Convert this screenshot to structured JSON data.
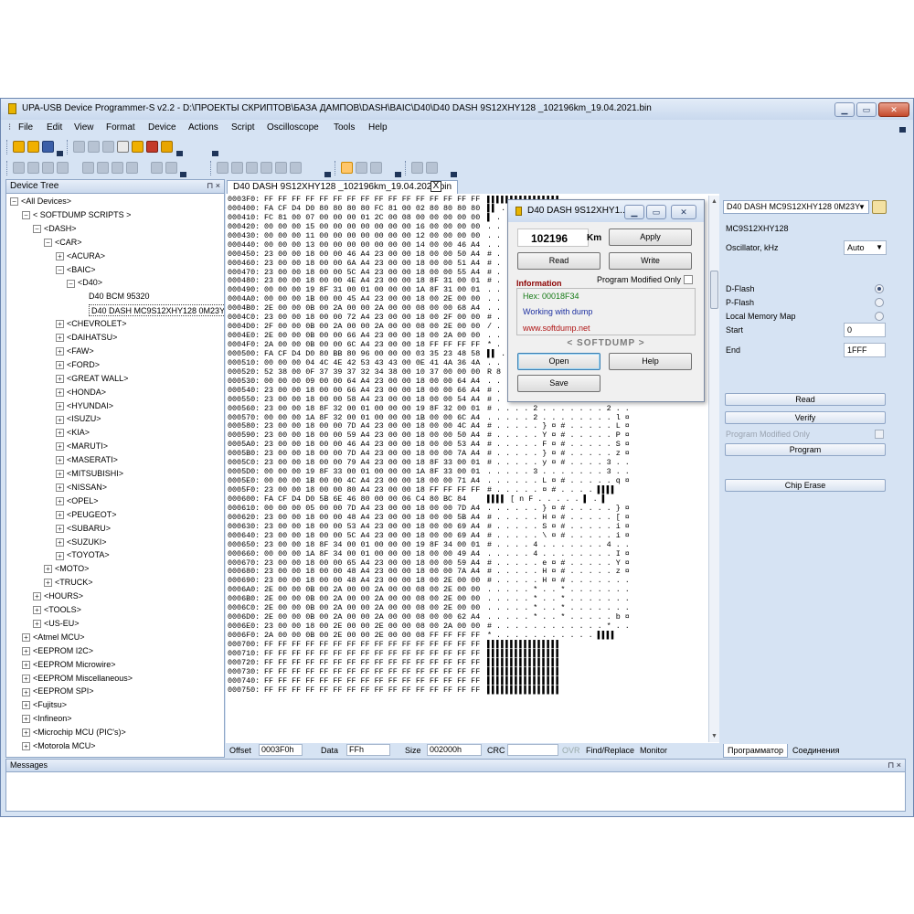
{
  "window": {
    "title": "UPA-USB Device Programmer-S v2.2 - D:\\ПРОЕКТЫ СКРИПТОВ\\БАЗА ДАМПОВ\\DASH\\BAIC\\D40\\D40 DASH 9S12XHY128 _102196km_19.04.2021.bin"
  },
  "menu": [
    "File",
    "Edit",
    "View",
    "Format",
    "Device",
    "Actions",
    "Script",
    "Oscilloscope",
    "Tools",
    "Help"
  ],
  "device_tree": {
    "title": "Device Tree",
    "pin": "⊓ ×",
    "nodes": [
      {
        "label": "<All Devices>",
        "box": "−"
      },
      {
        "label": "< SOFTDUMP SCRIPTS >",
        "box": "−"
      },
      {
        "label": "<DASH>",
        "box": "−"
      },
      {
        "label": "<CAR>",
        "box": "−"
      },
      {
        "label": "<ACURA>",
        "box": "+"
      },
      {
        "label": "<BAIC>",
        "box": "−"
      },
      {
        "label": "<D40>",
        "box": "−"
      },
      {
        "label": "D40 BCM 95320",
        "box": ""
      },
      {
        "label": "D40 DASH MC9S12XHY128 0M23Y",
        "box": ""
      },
      {
        "label": "<CHEVROLET>",
        "box": "+"
      },
      {
        "label": "<DAIHATSU>",
        "box": "+"
      },
      {
        "label": "<FAW>",
        "box": "+"
      },
      {
        "label": "<FORD>",
        "box": "+"
      },
      {
        "label": "<GREAT WALL>",
        "box": "+"
      },
      {
        "label": "<HONDA>",
        "box": "+"
      },
      {
        "label": "<HYUNDAI>",
        "box": "+"
      },
      {
        "label": "<ISUZU>",
        "box": "+"
      },
      {
        "label": "<KIA>",
        "box": "+"
      },
      {
        "label": "<MARUTI>",
        "box": "+"
      },
      {
        "label": "<MASERATI>",
        "box": "+"
      },
      {
        "label": "<MITSUBISHI>",
        "box": "+"
      },
      {
        "label": "<NISSAN>",
        "box": "+"
      },
      {
        "label": "<OPEL>",
        "box": "+"
      },
      {
        "label": "<PEUGEOT>",
        "box": "+"
      },
      {
        "label": "<SUBARU>",
        "box": "+"
      },
      {
        "label": "<SUZUKI>",
        "box": "+"
      },
      {
        "label": "<TOYOTA>",
        "box": "+"
      },
      {
        "label": "<MOTO>",
        "box": "+"
      },
      {
        "label": "<TRUCK>",
        "box": "+"
      },
      {
        "label": "<HOURS>",
        "box": "+"
      },
      {
        "label": "<TOOLS>",
        "box": "+"
      },
      {
        "label": "<US-EU>",
        "box": "+"
      },
      {
        "label": "<Atmel MCU>",
        "box": "+"
      },
      {
        "label": "<EEPROM I2C>",
        "box": "+"
      },
      {
        "label": "<EEPROM Microwire>",
        "box": "+"
      },
      {
        "label": "<EEPROM Miscellaneous>",
        "box": "+"
      },
      {
        "label": "<EEPROM SPI>",
        "box": "+"
      },
      {
        "label": "<Fujitsu>",
        "box": "+"
      },
      {
        "label": "<Infineon>",
        "box": "+"
      },
      {
        "label": "<Microchip MCU (PIC's)>",
        "box": "+"
      },
      {
        "label": "<Motorola MCU>",
        "box": "+"
      }
    ]
  },
  "doc_tab": {
    "label": "D40 DASH 9S12XHY128 _102196km_19.04.2021.bin",
    "close": "X"
  },
  "hex_rows": [
    [
      "0003F0:",
      "FF FF FF FF FF FF FF FF FF FF FF FF FF FF FF FF",
      "▌▌▌▌▌▌▌▌▌▌▌▌▌▌▌▌"
    ],
    [
      "000400:",
      "FA CF D4 D0 80 80 80 80 FC 81 00 02 80 80 80 80",
      "▌▌ . . . . . . . . . . . . . ."
    ],
    [
      "000410:",
      "FC 81 00 07 00 00 00 01 2C 00 08 00 00 00 00 00",
      "▌ . . . . . . . , . . . . . . ."
    ],
    [
      "000420:",
      "00 00 00 15 00 00 00 00 00 00 00 16 00 00 00 00",
      ". . . . . . . . . . . . . . . ."
    ],
    [
      "000430:",
      "00 00 00 11 00 00 00 00 00 00 00 12 00 00 00 00",
      ". . . . . . . . . . . . . . . ."
    ],
    [
      "000440:",
      "00 00 00 13 00 00 00 00 00 00 00 14 00 00 46 A4",
      ". . . . . . . . . . . . . . F ¤"
    ],
    [
      "000450:",
      "23 00 00 18 00 00 46 A4 23 00 00 18 00 00 50 A4",
      "# . . . . . F ¤ # . . . . . P ¤"
    ],
    [
      "000460:",
      "23 00 00 18 00 00 6A A4 23 00 00 18 00 00 51 A4",
      "# . . . . . j ¤ # . . . . . Q ¤"
    ],
    [
      "000470:",
      "23 00 00 18 00 00 5C A4 23 00 00 18 00 00 55 A4",
      "# . . . . . \\ ¤ # . . . . . U ¤"
    ],
    [
      "000480:",
      "23 00 00 18 00 00 4E A4 23 00 00 18 8F 31 00 01",
      "# . . . . . N ¤ # . . . . 1 . ."
    ],
    [
      "000490:",
      "00 00 00 19 8F 31 00 01 00 00 00 1A 8F 31 00 01",
      ". . . . . 1 . . . . . . . 1 . ."
    ],
    [
      "0004A0:",
      "00 00 00 1B 00 00 45 A4 23 00 00 18 00 2E 00 00",
      ". . . . . . E ¤ # . . . . . . ."
    ],
    [
      "0004B0:",
      "2E 00 00 0B 00 2A 00 00 2A 00 00 08 00 00 68 A4",
      ". . . . . * . . * . . . . . h ¤"
    ],
    [
      "0004C0:",
      "23 00 00 18 00 00 72 A4 23 00 00 18 00 2F 00 00",
      "# . . . . . r ¤ # . . . . / . ."
    ],
    [
      "0004D0:",
      "2F 00 00 0B 00 2A 00 00 2A 00 00 08 00 2E 00 00",
      "/ . . . . * . . * . . . . . . ."
    ],
    [
      "0004E0:",
      "2E 00 00 0B 00 00 66 A4 23 00 00 18 00 2A 00 00",
      ". . . . . . f ¤ # . . . . * . ."
    ],
    [
      "0004F0:",
      "2A 00 00 0B 00 00 6C A4 23 00 00 18 FF FF FF FF",
      "* . . . . . l ¤ # . . . ▌▌▌▌"
    ],
    [
      "000500:",
      "FA CF D4 D0 80 BB 80 96 00 00 00 03 35 23 48 58",
      "▌▌ . . . . . . . . . . 5 # H X"
    ],
    [
      "000510:",
      "00 00 00 04 4C 4E 42 53 43 43 00 0E 41 4A 36 4A",
      ". . . . L N B S C C . . A J 6 J"
    ],
    [
      "000520:",
      "52 38 00 0F 37 39 37 32 34 38 00 10 37 00 00 00",
      "R 8 . . 7 9 7 2 4 8 . . 7 . . ."
    ],
    [
      "000530:",
      "00 00 00 09 00 00 64 A4 23 00 00 18 00 00 64 A4",
      ". . . . . . d ¤ # . . . . . d ¤"
    ],
    [
      "000540:",
      "23 00 00 18 00 00 66 A4 23 00 00 18 00 00 66 A4",
      "# . . . . . ¤ # . . . . . . f ¤"
    ],
    [
      "000550:",
      "23 00 00 18 00 00 58 A4 23 00 00 18 00 00 54 A4",
      "# . . . . . X ¤ # . . . . . T ¤"
    ],
    [
      "000560:",
      "23 00 00 18 8F 32 00 01 00 00 00 19 8F 32 00 01",
      "# . . . . 2 . . . . . . . 2 . ."
    ],
    [
      "000570:",
      "00 00 00 1A 8F 32 00 01 00 00 00 1B 00 00 6C A4",
      ". . . . . 2 . . . . . . . . l ¤"
    ],
    [
      "000580:",
      "23 00 00 18 00 00 7D A4 23 00 00 18 00 00 4C A4",
      "# . . . . . } ¤ # . . . . . L ¤"
    ],
    [
      "000590:",
      "23 00 00 18 00 00 59 A4 23 00 00 18 00 00 50 A4",
      "# . . . . . Y ¤ # . . . . . P ¤"
    ],
    [
      "0005A0:",
      "23 00 00 18 00 00 46 A4 23 00 00 18 00 00 53 A4",
      "# . . . . . F ¤ # . . . . . S ¤"
    ],
    [
      "0005B0:",
      "23 00 00 18 00 00 7D A4 23 00 00 18 00 00 7A A4",
      "# . . . . . } ¤ # . . . . . z ¤"
    ],
    [
      "0005C0:",
      "23 00 00 18 00 00 79 A4 23 00 00 18 8F 33 00 01",
      "# . . . . . y ¤ # . . . . 3 . ."
    ],
    [
      "0005D0:",
      "00 00 00 19 8F 33 00 01 00 00 00 1A 8F 33 00 01",
      ". . . . . 3 . . . . . . . 3 . ."
    ],
    [
      "0005E0:",
      "00 00 00 1B 00 00 4C A4 23 00 00 18 00 00 71 A4",
      ". . . . . . L ¤ # . . . . . q ¤"
    ],
    [
      "0005F0:",
      "23 00 00 18 00 00 80 A4 23 00 00 18 FF FF FF FF",
      "# . . . . . ¤ # . . . . ▌▌▌▌"
    ],
    [
      "000600:",
      "FA CF D4 D0 5B 6E 46 80 00 00 06 C4 80 BC 84",
      "▌▌▌▌ [ n F . . . . . ▌ . ▌"
    ],
    [
      "000610:",
      "00 00 00 05 00 00 7D A4 23 00 00 18 00 00 7D A4",
      ". . . . . . } ¤ # . . . . . } ¤"
    ],
    [
      "000620:",
      "23 00 00 18 00 00 48 A4 23 00 00 18 00 00 5B A4",
      "# . . . . . H ¤ # . . . . . [ ¤"
    ],
    [
      "000630:",
      "23 00 00 18 00 00 53 A4 23 00 00 18 00 00 69 A4",
      "# . . . . . S ¤ # . . . . . i ¤"
    ],
    [
      "000640:",
      "23 00 00 18 00 00 5C A4 23 00 00 18 00 00 69 A4",
      "# . . . . . \\ ¤ # . . . . . i ¤"
    ],
    [
      "000650:",
      "23 00 00 18 8F 34 00 01 00 00 00 19 8F 34 00 01",
      "# . . . . 4 . . . . . . . 4 . ."
    ],
    [
      "000660:",
      "00 00 00 1A 8F 34 00 01 00 00 00 18 00 00 49 A4",
      ". . . . . 4 . . . . . . . . I ¤"
    ],
    [
      "000670:",
      "23 00 00 18 00 00 65 A4 23 00 00 18 00 00 59 A4",
      "# . . . . . e ¤ # . . . . . Y ¤"
    ],
    [
      "000680:",
      "23 00 00 18 00 00 48 A4 23 00 00 18 00 00 7A A4",
      "# . . . . . H ¤ # . . . . . z ¤"
    ],
    [
      "000690:",
      "23 00 00 18 00 00 48 A4 23 00 00 18 00 2E 00 00",
      "# . . . . . H ¤ # . . . . . . ."
    ],
    [
      "0006A0:",
      "2E 00 00 0B 00 2A 00 00 2A 00 00 08 00 2E 00 00",
      ". . . . . * . . * . . . . . . ."
    ],
    [
      "0006B0:",
      "2E 00 00 0B 00 2A 00 00 2A 00 00 08 00 2E 00 00",
      ". . . . . * . . * . . . . . . ."
    ],
    [
      "0006C0:",
      "2E 00 00 0B 00 2A 00 00 2A 00 00 08 00 2E 00 00",
      ". . . . . * . . * . . . . . . ."
    ],
    [
      "0006D0:",
      "2E 00 00 0B 00 2A 00 00 2A 00 00 08 00 00 62 A4",
      ". . . . . * . . * . . . . . b ¤"
    ],
    [
      "0006E0:",
      "23 00 00 18 00 2E 00 00 2E 00 00 08 00 2A 00 00",
      "# . . . . . . . . . . . . * . ."
    ],
    [
      "0006F0:",
      "2A 00 00 0B 00 2E 00 00 2E 00 00 08 FF FF FF FF",
      "* . . . . . . . . . . . ▌▌▌▌"
    ],
    [
      "000700:",
      "FF FF FF FF FF FF FF FF FF FF FF FF FF FF FF FF",
      "▌▌▌▌▌▌▌▌▌▌▌▌▌▌▌▌"
    ],
    [
      "000710:",
      "FF FF FF FF FF FF FF FF FF FF FF FF FF FF FF FF",
      "▌▌▌▌▌▌▌▌▌▌▌▌▌▌▌▌"
    ],
    [
      "000720:",
      "FF FF FF FF FF FF FF FF FF FF FF FF FF FF FF FF",
      "▌▌▌▌▌▌▌▌▌▌▌▌▌▌▌▌"
    ],
    [
      "000730:",
      "FF FF FF FF FF FF FF FF FF FF FF FF FF FF FF FF",
      "▌▌▌▌▌▌▌▌▌▌▌▌▌▌▌▌"
    ],
    [
      "000740:",
      "FF FF FF FF FF FF FF FF FF FF FF FF FF FF FF FF",
      "▌▌▌▌▌▌▌▌▌▌▌▌▌▌▌▌"
    ],
    [
      "000750:",
      "FF FF FF FF FF FF FF FF FF FF FF FF FF FF FF FF",
      "▌▌▌▌▌▌▌▌▌▌▌▌▌▌▌▌"
    ]
  ],
  "status": {
    "offset_label": "Offset",
    "offset_value": "0003F0h",
    "data_label": "Data",
    "data_value": "FFh",
    "size_label": "Size",
    "size_value": "002000h",
    "crc_label": "CRC",
    "crc_value": "",
    "ovr": "OVR",
    "find_replace": "Find/Replace",
    "monitor": "Monitor"
  },
  "right_panel": {
    "chip_select": "D40 DASH MC9S12XHY128 0M23Y",
    "chip_name": "MC9S12XHY128",
    "oscillator_label": "Oscillator, kHz",
    "oscillator_value": "Auto",
    "dflash": "D-Flash",
    "pflash": "P-Flash",
    "local_memory": "Local Memory Map",
    "start_label": "Start",
    "start_value": "0",
    "end_label": "End",
    "end_value": "1FFF",
    "read": "Read",
    "verify": "Verify",
    "program_modified_only": "Program Modified Only",
    "program": "Program",
    "chip_erase": "Chip Erase",
    "tab_programmer": "Программатор",
    "tab_connections": "Соединения"
  },
  "messages": {
    "title": "Messages",
    "pin": "⊓ ×"
  },
  "dialog": {
    "title": "D40 DASH 9S12XHY1...",
    "km_value": "102196",
    "km_unit": "Km",
    "apply": "Apply",
    "read": "Read",
    "write": "Write",
    "info_label": "Information",
    "program_modified_only": "Program Modified Only",
    "hex": "Hex: 00018F34",
    "working": "Working with dump",
    "site": "www.softdump.net",
    "brand": "< SOFTDUMP >",
    "open": "Open",
    "help": "Help",
    "save": "Save"
  },
  "colors": {
    "accent": "#d6e3f3",
    "info_green": "#157a15",
    "info_blue": "#1c2fa0",
    "info_red": "#b01515"
  }
}
